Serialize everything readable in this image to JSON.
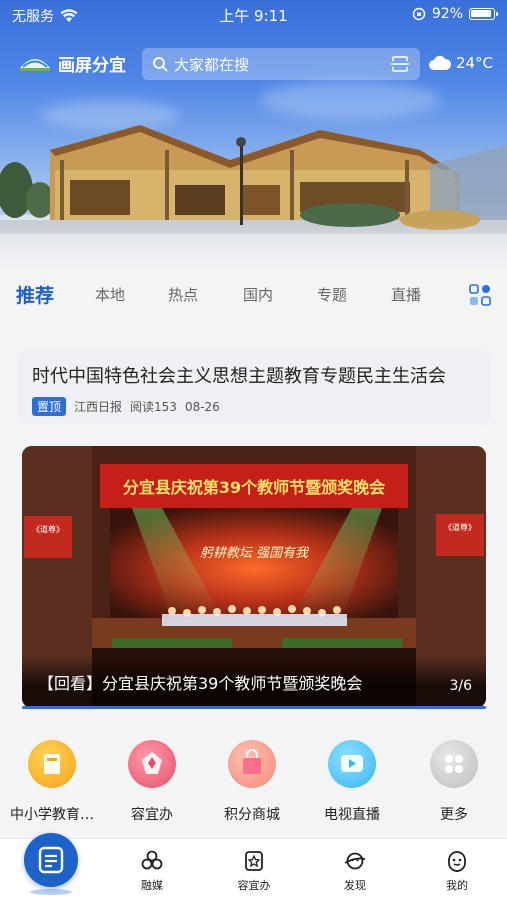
{
  "status_bar": {
    "carrier": "无服务",
    "time": "上午 9:11",
    "battery": "92%"
  },
  "header": {
    "logo_text": "画屏分宜",
    "search_placeholder": "大家都在搜",
    "temperature": "24°C"
  },
  "tabs": [
    {
      "label": "推荐",
      "active": true
    },
    {
      "label": "本地",
      "active": false
    },
    {
      "label": "热点",
      "active": false
    },
    {
      "label": "国内",
      "active": false
    },
    {
      "label": "专题",
      "active": false
    },
    {
      "label": "直播",
      "active": false
    }
  ],
  "pinned_article": {
    "title": "时代中国特色社会主义思想主题教育专题民主生活会",
    "tag": "置顶",
    "source": "江西日报",
    "reads": "阅读153",
    "date": "08-26"
  },
  "banner": {
    "backdrop_text": "分宜县庆祝第39个教师节暨颁奖晚会",
    "screen_text": "躬耕教坛 强国有我",
    "side_banner_text": "《道尊》",
    "title": "【回看】分宜县庆祝第39个教师节暨颁奖晚会",
    "pager": "3/6"
  },
  "quick_entries": [
    {
      "label": "中小学教育…",
      "icon": "education-icon",
      "color": "#f5b321"
    },
    {
      "label": "容宜办",
      "icon": "service-icon",
      "color": "#e6506a"
    },
    {
      "label": "积分商城",
      "icon": "shopping-bag-icon",
      "color": "#f28a7a"
    },
    {
      "label": "电视直播",
      "icon": "tv-icon",
      "color": "#35b6f0"
    },
    {
      "label": "更多",
      "icon": "more-icon",
      "color": "#c9c9c9"
    }
  ],
  "bottom_nav": [
    {
      "label": "融媒",
      "icon": "media-icon"
    },
    {
      "label": "容宜办",
      "icon": "star-doc-icon"
    },
    {
      "label": "发现",
      "icon": "discover-icon"
    },
    {
      "label": "我的",
      "icon": "profile-icon"
    }
  ]
}
